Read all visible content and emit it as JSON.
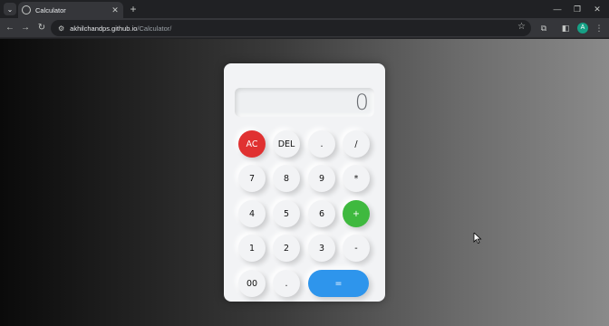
{
  "browser": {
    "tab_title": "Calculator",
    "url_host": "akhilchandps.github.io",
    "url_path": "/Calculator/",
    "profile_initial": "A"
  },
  "calculator": {
    "display_value": "0",
    "keys": {
      "ac": "AC",
      "del": "DEL",
      "dot_top": ".",
      "divide": "/",
      "seven": "7",
      "eight": "8",
      "nine": "9",
      "multiply": "*",
      "four": "4",
      "five": "5",
      "six": "6",
      "plus": "+",
      "one": "1",
      "two": "2",
      "three": "3",
      "minus": "-",
      "double_zero": "00",
      "dot_bottom": ".",
      "equals": "="
    },
    "colors": {
      "ac": "#e03131",
      "plus": "#3fb93f",
      "equals": "#2e95ec"
    }
  }
}
